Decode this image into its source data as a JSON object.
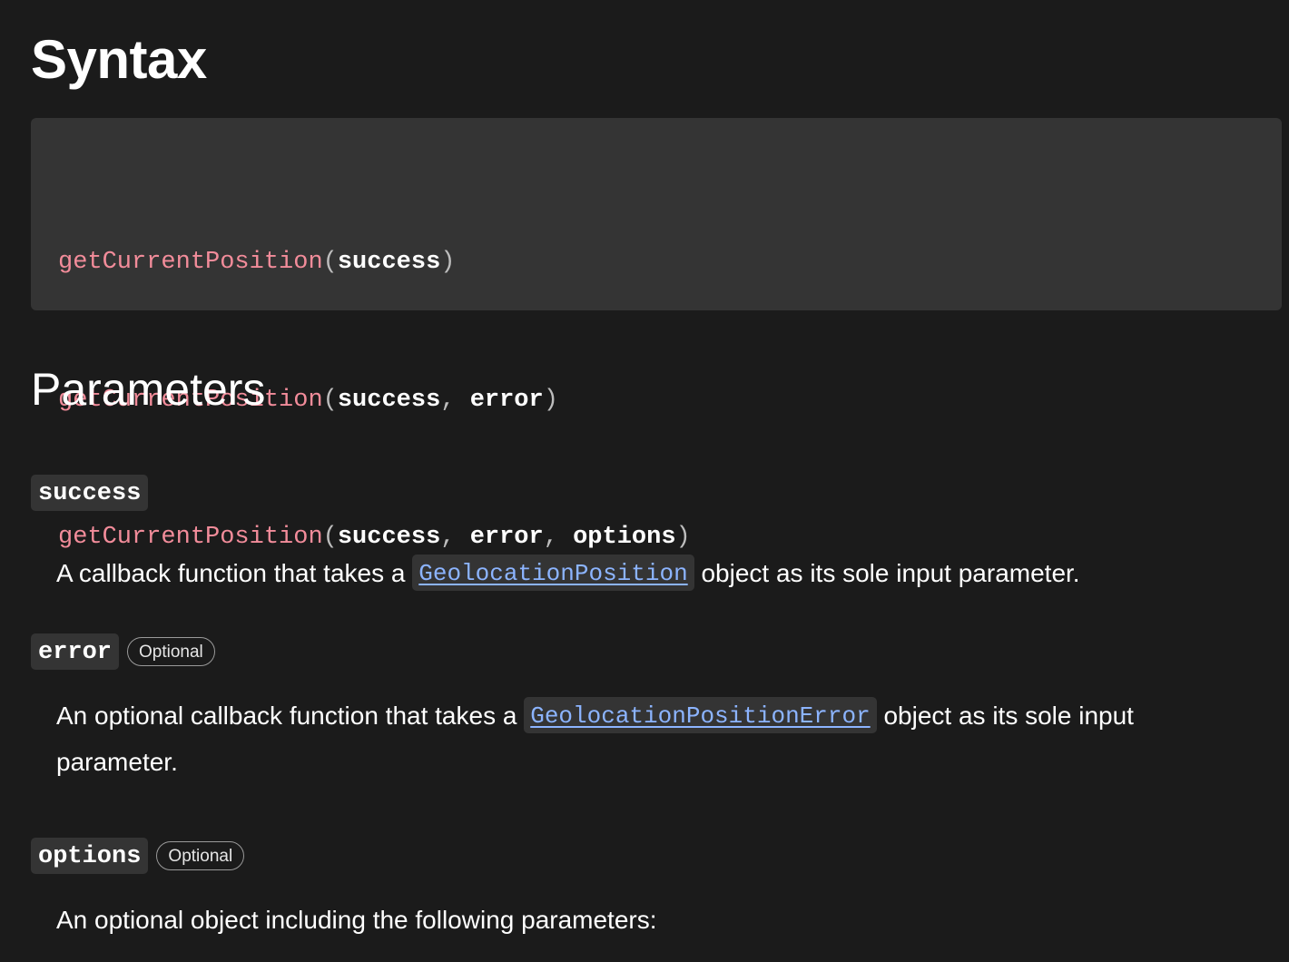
{
  "syntax": {
    "heading": "Syntax",
    "code_lines": [
      {
        "fn": "getCurrentPosition",
        "open": "(",
        "args": [
          "success"
        ],
        "close": ")"
      },
      {
        "fn": "getCurrentPosition",
        "open": "(",
        "args": [
          "success",
          "error"
        ],
        "close": ")"
      },
      {
        "fn": "getCurrentPosition",
        "open": "(",
        "args": [
          "success",
          "error",
          "options"
        ],
        "close": ")"
      }
    ],
    "separator": ", "
  },
  "parameters": {
    "heading": "Parameters",
    "items": [
      {
        "name": "success",
        "badge": "",
        "desc_before": "A callback function that takes a ",
        "link": "GeolocationPosition",
        "desc_after": " object as its sole input parameter."
      },
      {
        "name": "error",
        "badge": "Optional",
        "desc_before": "An optional callback function that takes a ",
        "link": "GeolocationPositionError",
        "desc_after": " object as its sole input parameter."
      },
      {
        "name": "options",
        "badge": "Optional",
        "desc_before": "An optional object including the following parameters:",
        "link": "",
        "desc_after": ""
      }
    ]
  },
  "colors": {
    "background": "#1b1b1b",
    "code_background": "#343434",
    "function_name": "#f28c9a",
    "link": "#8cb4ff"
  }
}
